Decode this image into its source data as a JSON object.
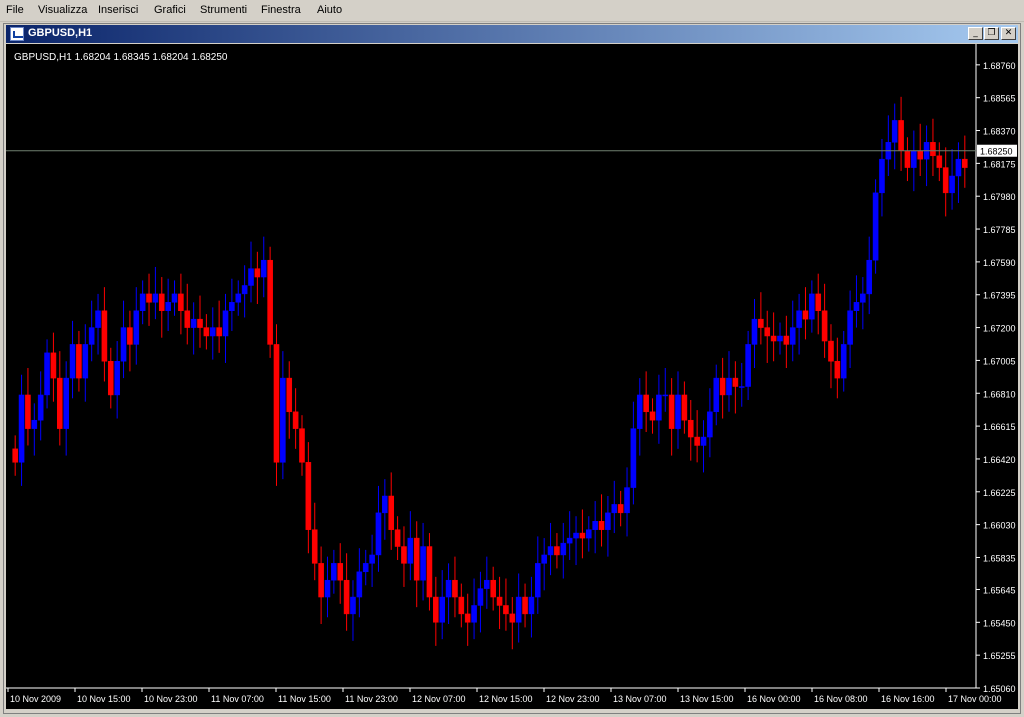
{
  "menu": [
    "File",
    "Visualizza",
    "Inserisci",
    "Grafici",
    "Strumenti",
    "Finestra",
    "Aiuto"
  ],
  "window": {
    "title": "GBPUSD,H1",
    "buttons": {
      "minimize": "_",
      "restore": "❐",
      "close": "✕"
    }
  },
  "colors": {
    "background": "#000000",
    "bull": "#0000ff",
    "bear": "#ff0000",
    "bull_outline": "#90ee90",
    "axis": "#ffffff",
    "price_line": "#708070"
  },
  "chart_data": {
    "type": "candlestick",
    "symbol": "GBPUSD",
    "timeframe": "H1",
    "info_line": "GBPUSD,H1  1.68204 1.68345 1.68204 1.68250",
    "current_price": "1.68250",
    "ylim": [
      1.6506,
      1.6886
    ],
    "y_ticks": [
      "1.68760",
      "1.68565",
      "1.68370",
      "1.68175",
      "1.67980",
      "1.67785",
      "1.67590",
      "1.67395",
      "1.67200",
      "1.67005",
      "1.66810",
      "1.66615",
      "1.66420",
      "1.66225",
      "1.66030",
      "1.65835",
      "1.65645",
      "1.65450",
      "1.65255",
      "1.65060"
    ],
    "x_ticks": [
      "10 Nov 2009",
      "10 Nov 15:00",
      "10 Nov 23:00",
      "11 Nov 07:00",
      "11 Nov 15:00",
      "11 Nov 23:00",
      "12 Nov 07:00",
      "12 Nov 15:00",
      "12 Nov 23:00",
      "13 Nov 07:00",
      "13 Nov 15:00",
      "16 Nov 00:00",
      "16 Nov 08:00",
      "16 Nov 16:00",
      "17 Nov 00:00"
    ],
    "closes": [
      1.664,
      1.668,
      1.666,
      1.6665,
      1.668,
      1.6705,
      1.669,
      1.666,
      1.669,
      1.671,
      1.669,
      1.671,
      1.672,
      1.673,
      1.67,
      1.668,
      1.67,
      1.672,
      1.671,
      1.673,
      1.674,
      1.6735,
      1.674,
      1.673,
      1.6735,
      1.674,
      1.673,
      1.672,
      1.6725,
      1.672,
      1.6715,
      1.672,
      1.6715,
      1.673,
      1.6735,
      1.674,
      1.6745,
      1.6755,
      1.675,
      1.676,
      1.671,
      1.664,
      1.669,
      1.667,
      1.666,
      1.664,
      1.66,
      1.658,
      1.656,
      1.657,
      1.658,
      1.657,
      1.655,
      1.656,
      1.6575,
      1.658,
      1.6585,
      1.661,
      1.662,
      1.66,
      1.659,
      1.658,
      1.6595,
      1.657,
      1.659,
      1.656,
      1.6545,
      1.656,
      1.657,
      1.656,
      1.655,
      1.6545,
      1.6555,
      1.6565,
      1.657,
      1.656,
      1.6555,
      1.655,
      1.6545,
      1.656,
      1.655,
      1.656,
      1.658,
      1.6585,
      1.659,
      1.6585,
      1.6592,
      1.6595,
      1.6598,
      1.6595,
      1.66,
      1.6605,
      1.66,
      1.661,
      1.6615,
      1.661,
      1.6625,
      1.666,
      1.668,
      1.667,
      1.6665,
      1.668,
      1.668,
      1.666,
      1.668,
      1.6665,
      1.6655,
      1.665,
      1.6655,
      1.667,
      1.669,
      1.668,
      1.669,
      1.6685,
      1.6685,
      1.671,
      1.6725,
      1.672,
      1.6715,
      1.6712,
      1.6715,
      1.671,
      1.672,
      1.673,
      1.6725,
      1.674,
      1.673,
      1.6712,
      1.67,
      1.669,
      1.671,
      1.673,
      1.6735,
      1.674,
      1.676,
      1.68,
      1.682,
      1.683,
      1.6843,
      1.6825,
      1.6815,
      1.6825,
      1.682,
      1.683,
      1.6822,
      1.6815,
      1.68,
      1.681,
      1.682,
      1.6815
    ]
  }
}
